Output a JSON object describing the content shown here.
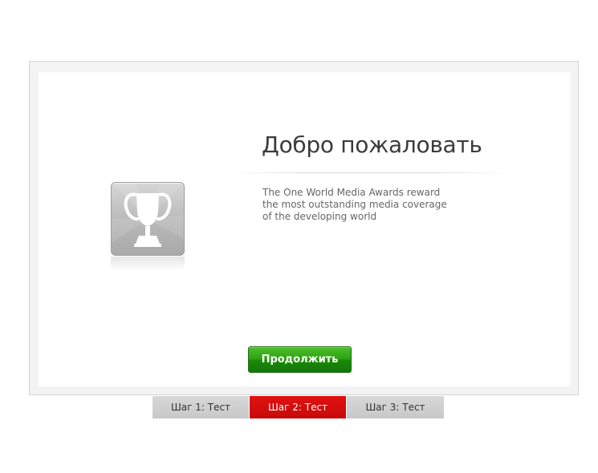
{
  "welcome": {
    "title": "Добро пожаловать",
    "description": "The One World Media Awards reward the most outstanding media coverage of the developing world",
    "icon": "trophy-icon",
    "continue_label": "Продолжить"
  },
  "steps": [
    {
      "label": "Шаг 1: Тест",
      "active": false
    },
    {
      "label": "Шаг 2: Тест",
      "active": true
    },
    {
      "label": "Шаг 3: Тест",
      "active": false
    }
  ],
  "colors": {
    "button_green": "#2ea114",
    "active_step_red": "#d40d0d",
    "inactive_step_gray": "#d0d0d0"
  }
}
